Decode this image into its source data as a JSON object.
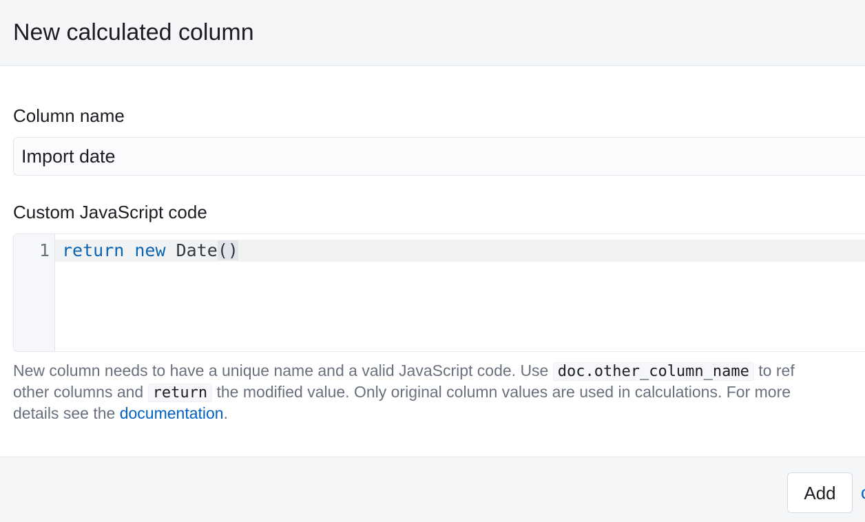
{
  "modal": {
    "title": "New calculated column"
  },
  "form": {
    "column_name_label": "Column name",
    "column_name_value": "Import date",
    "code_label": "Custom JavaScript code",
    "code": {
      "line_number": "1",
      "keyword_return": "return",
      "keyword_new": "new",
      "identifier": "Date",
      "parens": "()"
    },
    "help": {
      "line1_prefix": "New column needs to have a unique name and a valid JavaScript code. Use ",
      "code_ref": "doc.other_column_name",
      "line1_suffix": " to ref",
      "line2_prefix": "other columns and ",
      "code_return": "return",
      "line2_suffix": " the modified value. Only original column values are used in calculations. For more",
      "line3_prefix": "details see the ",
      "link_label": "documentation",
      "line3_suffix": "."
    }
  },
  "footer": {
    "add_label": "Add",
    "cut_off_label": "c"
  },
  "colors": {
    "header_bg": "#f5f6f8",
    "keyword": "#0b64b0",
    "link": "#0061c2",
    "help_text": "#69707d"
  }
}
